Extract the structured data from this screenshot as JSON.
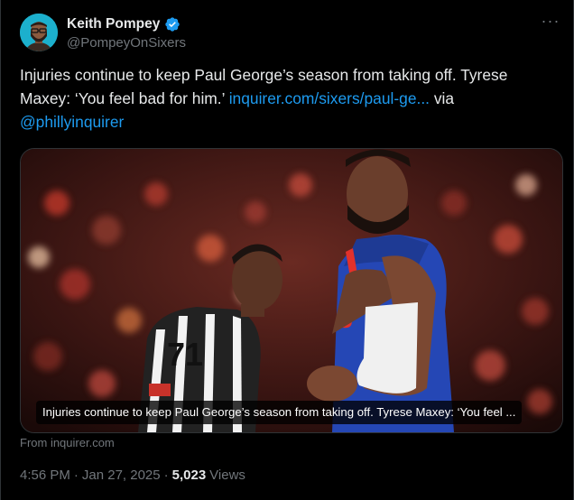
{
  "author": {
    "name": "Keith Pompey",
    "handle": "@PompeyOnSixers",
    "verified_icon": "verified-badge-icon"
  },
  "more_menu": {
    "label": "···"
  },
  "tweet": {
    "text_before": "Injuries continue to keep Paul George’s season from taking off. Tyrese Maxey: ‘You feel bad for him.’ ",
    "link": "inquirer.com/sixers/paul-ge...",
    "text_mid": " via ",
    "mention": "@phillyinquirer"
  },
  "card": {
    "caption": "Injuries continue to keep Paul George’s season from taking off. Tyrese Maxey: ‘You feel ...",
    "source": "From inquirer.com",
    "jersey_number": "71",
    "photo_text": "Injuries continue to keep Paul George’s season from taking off"
  },
  "meta": {
    "time": "4:56 PM",
    "dot1": "·",
    "date": "Jan 27, 2025",
    "dot2": "·",
    "views_count": "5,023",
    "views_label": "Views"
  },
  "colors": {
    "accent": "#1d9bf0",
    "text": "#e7e9ea",
    "muted": "#71767b",
    "background": "#000000"
  }
}
